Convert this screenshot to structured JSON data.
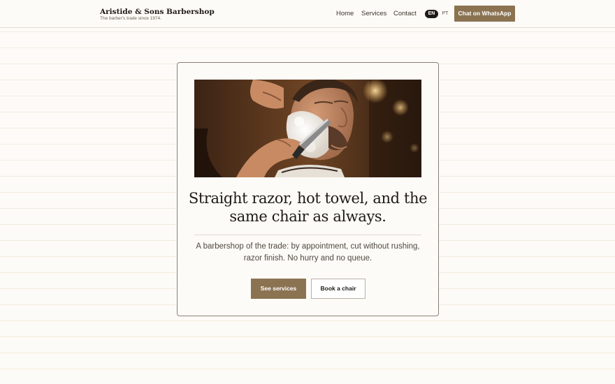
{
  "header": {
    "brand_name": "Aristide & Sons Barbershop",
    "brand_tagline": "The barber's trade since 1974.",
    "nav": [
      "Home",
      "Services",
      "Contact"
    ],
    "languages": [
      "EN",
      "PT"
    ],
    "active_language": "EN",
    "cta_label": "Chat on WhatsApp"
  },
  "hero": {
    "headline": "Straight razor, hot towel, and the same chair as always.",
    "description": "A barbershop of the trade: by appointment, cut without rushing, razor finish. No hurry and no queue.",
    "primary_button": "See services",
    "secondary_button": "Book a chair"
  },
  "colors": {
    "accent": "#8b7352",
    "background": "#fdfbf7",
    "text": "#1e1a16"
  }
}
